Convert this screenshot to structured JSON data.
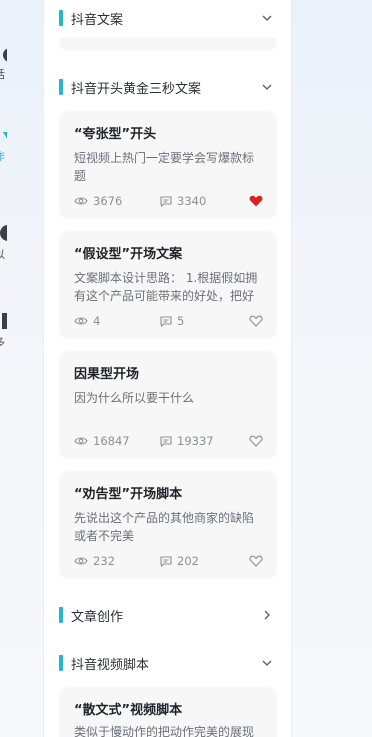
{
  "rail": {
    "items": [
      {
        "label": "话",
        "icon": "pin-icon"
      },
      {
        "label": "作",
        "icon": "pen-icon"
      },
      {
        "label": "以",
        "icon": "circle-icon"
      },
      {
        "label": "多",
        "icon": "doc-icon"
      }
    ]
  },
  "sections": {
    "s1": {
      "title": "抖音文案",
      "expanded": true
    },
    "s2": {
      "title": "抖音开头黄金三秒文案",
      "expanded": true
    },
    "s3": {
      "title": "文章创作",
      "expanded": false
    },
    "s4": {
      "title": "抖音视频脚本",
      "expanded": true
    }
  },
  "cards": [
    {
      "title": "“夸张型”开头",
      "desc": "短视频上热门一定要学会写爆款标题",
      "views": "3676",
      "comments": "3340",
      "liked": true
    },
    {
      "title": "“假设型”开场文案",
      "desc": "文案脚本设计思路： 1.根据假如拥有这个产品可能带来的好处，把好",
      "views": "4",
      "comments": "5",
      "liked": false
    },
    {
      "title": "因果型开场",
      "desc": "因为什么所以要干什么",
      "views": "16847",
      "comments": "19337",
      "liked": false
    },
    {
      "title": "“劝告型”开场脚本",
      "desc": "先说出这个产品的其他商家的缺陷或者不完美",
      "views": "232",
      "comments": "202",
      "liked": false
    },
    {
      "title": "“散文式”视频脚本",
      "desc": "类似于慢动作的把动作完美的展现"
    }
  ],
  "colors": {
    "accent": "#2bb3c9",
    "liked": "#e02020"
  }
}
